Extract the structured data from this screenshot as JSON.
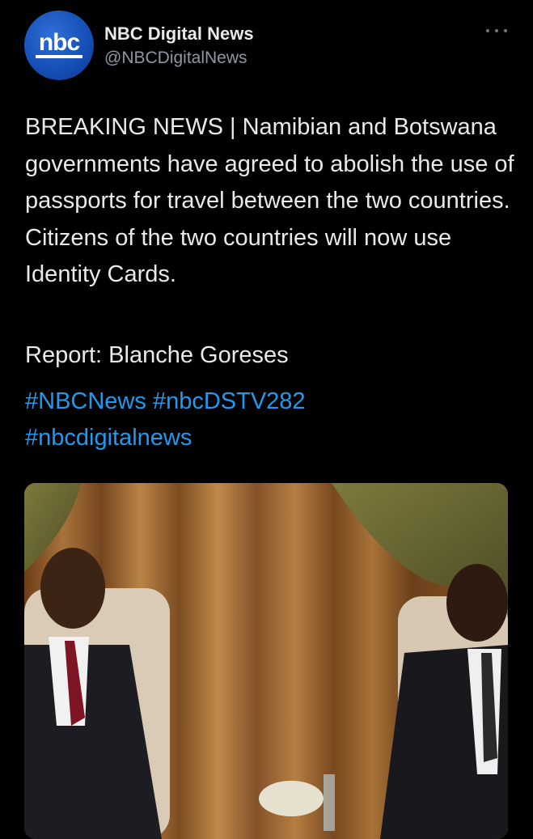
{
  "author": {
    "avatar_text": "nbc",
    "display_name": "NBC Digital News",
    "handle": "@NBCDigitalNews"
  },
  "tweet": {
    "text": "BREAKING NEWS | Namibian and Botswana governments have agreed to abolish the use of passports for travel between the two countries. Citizens of the two countries will now use Identity Cards.",
    "report": "Report: Blanche Goreses",
    "hashtags": [
      "#NBCNews",
      "#nbcDSTV282",
      "#nbcdigitalnews"
    ]
  },
  "icons": {
    "more": "more-options-icon"
  },
  "colors": {
    "background": "#000000",
    "text": "#e7e9ea",
    "secondary": "#8b98a5",
    "link": "#1d9bf0",
    "avatar_blue": "#1650b8"
  }
}
